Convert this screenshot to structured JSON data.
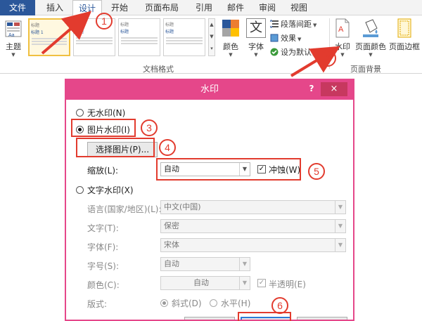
{
  "tabs": {
    "file": "文件",
    "insert": "插入",
    "design": "设计",
    "start": "开始",
    "layout": "页面布局",
    "references": "引用",
    "mailings": "邮件",
    "review": "审阅",
    "view": "视图"
  },
  "ribbon": {
    "theme_label": "主题",
    "colors_label": "颜色",
    "fonts_label": "字体",
    "fonts_glyph": "文",
    "paragraph_spacing": "段落间距",
    "effects": "效果",
    "set_default": "设为默认值",
    "watermark": "水印",
    "page_color": "页面颜色",
    "page_borders": "页面边框",
    "group_document_format": "文档格式",
    "group_page_background": "页面背景",
    "gallery": [
      {
        "title": "标题",
        "sub": "标题 1"
      },
      {
        "title": "标题",
        "sub": "标题"
      },
      {
        "title": "标题",
        "sub": "标题"
      },
      {
        "title": "标题",
        "sub": "标题"
      }
    ]
  },
  "dialog": {
    "title": "水印",
    "help": "?",
    "close": "×",
    "no_watermark": "无水印(N)",
    "picture_watermark": "图片水印(I)",
    "select_picture": "选择图片(P)...",
    "scale_label": "缩放(L):",
    "scale_value": "自动",
    "washout_label": "冲蚀(W)",
    "washout_checked": true,
    "text_watermark": "文字水印(X)",
    "language_label": "语言(国家/地区)(L):",
    "language_value": "中文(中国)",
    "text_label": "文字(T):",
    "text_value": "保密",
    "font_label": "字体(F):",
    "font_value": "宋体",
    "size_label": "字号(S):",
    "size_value": "自动",
    "color_label": "颜色(C):",
    "color_value": "自动",
    "semitransparent_label": "半透明(E)",
    "layout_label": "版式:",
    "diagonal_label": "斜式(D)",
    "horizontal_label": "水平(H)",
    "selected": "picture"
  },
  "callouts": [
    "1",
    "2",
    "3",
    "4",
    "5",
    "6"
  ],
  "colors": {
    "accent": "#2b579a",
    "dialog_titlebar": "#e5478a",
    "annotation_red": "#e23b2e"
  }
}
